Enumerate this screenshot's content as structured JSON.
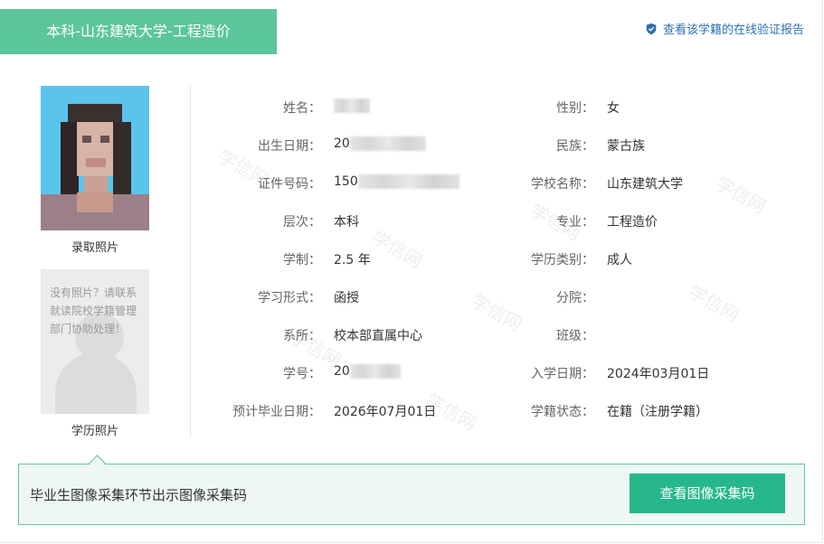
{
  "header": {
    "title": "本科-山东建筑大学-工程造价",
    "verify_link": "查看该学籍的在线验证报告"
  },
  "photos": {
    "admission_caption": "录取照片",
    "degree_caption": "学历照片",
    "no_photo_message": "没有照片？请联系就读院校学籍管理部门协助处理！"
  },
  "fields_left": [
    {
      "label": "姓名：",
      "value": ""
    },
    {
      "label": "出生日期：",
      "value": "20"
    },
    {
      "label": "证件号码：",
      "value": "150"
    },
    {
      "label": "层次：",
      "value": "本科"
    },
    {
      "label": "学制：",
      "value": "2.5 年"
    },
    {
      "label": "学习形式：",
      "value": "函授"
    },
    {
      "label": "系所：",
      "value": "校本部直属中心"
    },
    {
      "label": "学号：",
      "value": "20"
    },
    {
      "label": "预计毕业日期：",
      "value": "2026年07月01日"
    }
  ],
  "fields_right": [
    {
      "label": "性别：",
      "value": "女"
    },
    {
      "label": "民族：",
      "value": "蒙古族"
    },
    {
      "label": "学校名称：",
      "value": "山东建筑大学"
    },
    {
      "label": "专业：",
      "value": "工程造价"
    },
    {
      "label": "学历类别：",
      "value": "成人"
    },
    {
      "label": "分院：",
      "value": ""
    },
    {
      "label": "班级：",
      "value": ""
    },
    {
      "label": "入学日期：",
      "value": "2024年03月01日"
    },
    {
      "label": "学籍状态：",
      "value": "在籍（注册学籍）"
    }
  ],
  "watermark_text": "学信网",
  "bottom_bar": {
    "text": "毕业生图像采集环节出示图像采集码",
    "button": "查看图像采集码"
  },
  "colors": {
    "brand_green": "#5cc69a",
    "button_green": "#26b78a",
    "link_blue": "#2f6fb5"
  }
}
